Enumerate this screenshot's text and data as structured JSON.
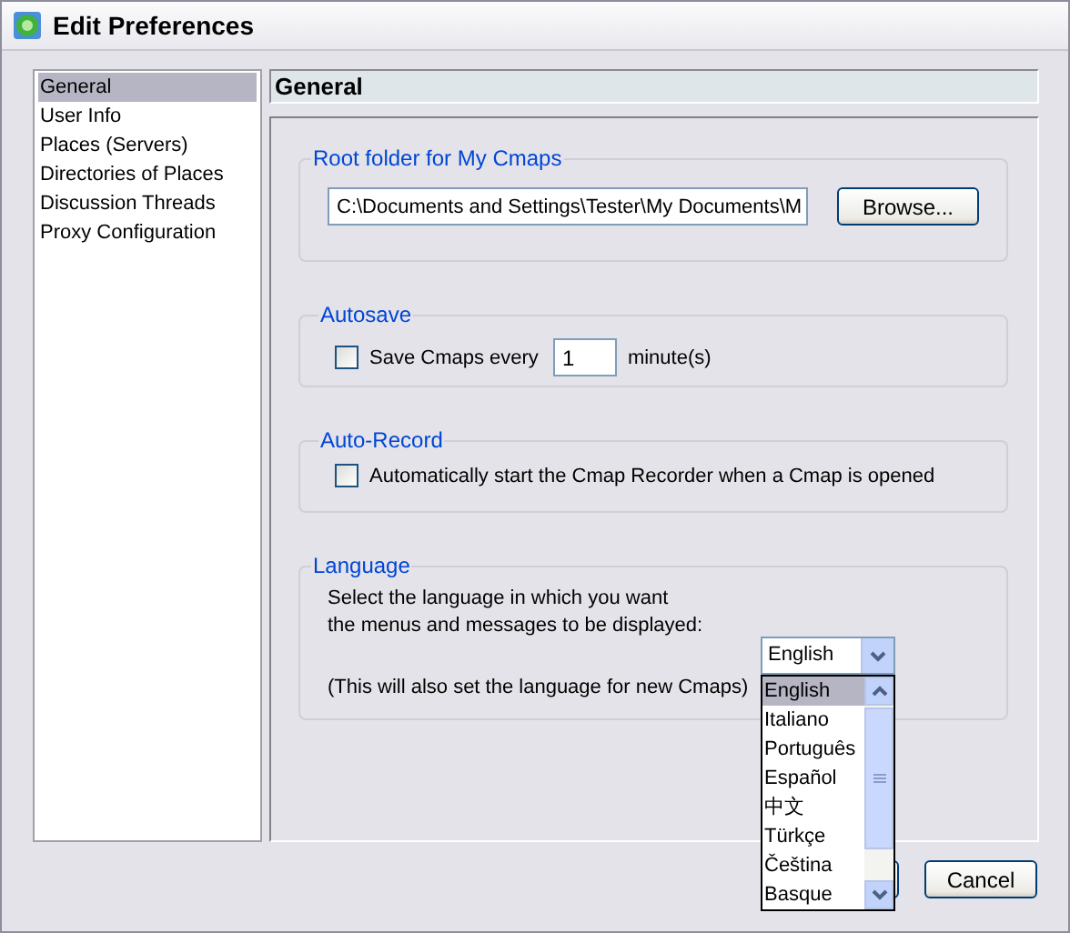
{
  "window": {
    "title": "Edit Preferences"
  },
  "sidebar": {
    "items": [
      {
        "label": "General",
        "selected": true
      },
      {
        "label": "User Info",
        "selected": false
      },
      {
        "label": "Places (Servers)",
        "selected": false
      },
      {
        "label": "Directories of Places",
        "selected": false
      },
      {
        "label": "Discussion Threads",
        "selected": false
      },
      {
        "label": "Proxy Configuration",
        "selected": false
      }
    ]
  },
  "panel": {
    "title": "General"
  },
  "root_folder": {
    "title": "Root folder for My Cmaps",
    "path": "C:\\Documents and Settings\\Tester\\My Documents\\M",
    "browse_button": "Browse..."
  },
  "autosave": {
    "title": "Autosave",
    "label": "Save Cmaps every",
    "checked": false,
    "minutes": "1",
    "unit": "minute(s)"
  },
  "auto_record": {
    "title": "Auto-Record",
    "label": "Automatically start the Cmap Recorder when a Cmap is opened",
    "checked": false
  },
  "language": {
    "title": "Language",
    "prompt": "Select the language in which you want\nthe menus and messages to be displayed:",
    "note": "(This will also set the language for new Cmaps)",
    "dropdown": {
      "value": "English",
      "expanded": true,
      "options": [
        {
          "label": "English",
          "selected": true
        },
        {
          "label": "Italiano",
          "selected": false
        },
        {
          "label": "Português",
          "selected": false
        },
        {
          "label": "Español",
          "selected": false
        },
        {
          "label": "中文",
          "selected": false
        },
        {
          "label": "Türkçe",
          "selected": false
        },
        {
          "label": "Čeština",
          "selected": false
        },
        {
          "label": "Basque",
          "selected": false
        }
      ]
    }
  },
  "buttons": [
    {
      "label": "Cancel"
    }
  ]
}
